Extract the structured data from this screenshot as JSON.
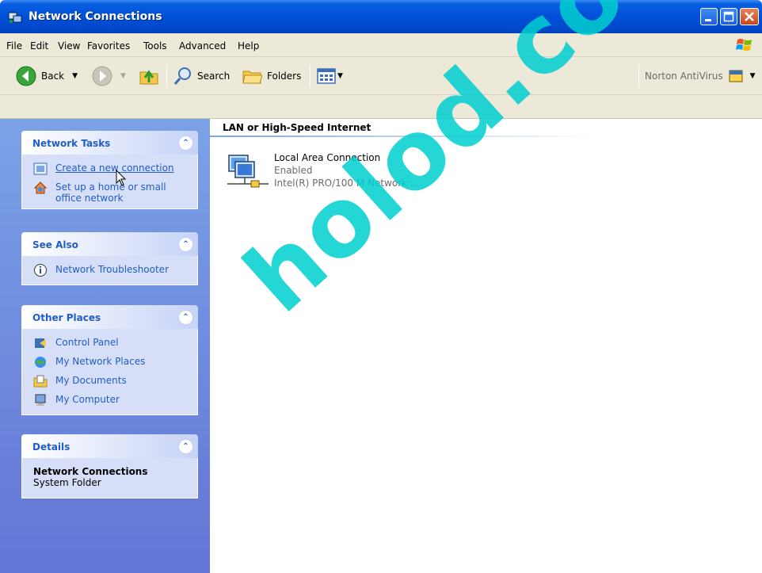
{
  "window": {
    "title": "Network Connections"
  },
  "menu": [
    "File",
    "Edit",
    "View",
    "Favorites",
    "Tools",
    "Advanced",
    "Help"
  ],
  "toolbar": {
    "back_label": "Back",
    "search_label": "Search",
    "folders_label": "Folders",
    "norton_label": "Norton AntiVirus"
  },
  "panels": {
    "network_tasks": {
      "title": "Network Tasks",
      "items": [
        "Create a new connection",
        "Set up a home or small office network"
      ]
    },
    "see_also": {
      "title": "See Also",
      "items": [
        "Network Troubleshooter"
      ]
    },
    "other_places": {
      "title": "Other Places",
      "items": [
        "Control Panel",
        "My Network Places",
        "My Documents",
        "My Computer"
      ]
    },
    "details": {
      "title": "Details",
      "name": "Network Connections",
      "type": "System Folder"
    }
  },
  "content": {
    "group_title": "LAN or High-Speed Internet",
    "connection": {
      "name": "Local Area Connection",
      "status": "Enabled",
      "device": "Intel(R) PRO/100 M Network ..."
    }
  },
  "watermark": "holod.com.ua",
  "colors": {
    "title_blue": "#0050d8",
    "panel_link": "#215dc6",
    "left_pane_top": "#7ba2e7",
    "left_pane_bottom": "#6375d6",
    "chrome": "#ece9d8",
    "watermark": "#00cfcf"
  }
}
